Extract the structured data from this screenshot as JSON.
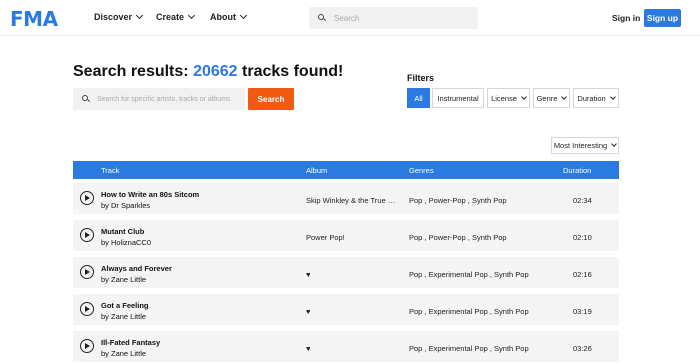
{
  "header": {
    "logo": "FMA",
    "nav": [
      {
        "label": "Discover"
      },
      {
        "label": "Create"
      },
      {
        "label": "About"
      }
    ],
    "search_placeholder": "Search",
    "signin": "Sign in",
    "signup": "Sign up"
  },
  "results": {
    "prefix": "Search results: ",
    "count": "20662",
    "suffix": " tracks found!",
    "search_placeholder": "Search for specific artists, tracks or albums",
    "search_button": "Search"
  },
  "filters": {
    "label": "Filters",
    "items": [
      {
        "label": "All",
        "active": true
      },
      {
        "label": "Instrumental",
        "active": false
      },
      {
        "label": "License",
        "active": false
      },
      {
        "label": "Genre",
        "active": false
      },
      {
        "label": "Duration",
        "active": false
      }
    ]
  },
  "sort": "Most Interesting",
  "table": {
    "headers": {
      "track": "Track",
      "album": "Album",
      "genres": "Genres",
      "duration": "Duration"
    },
    "rows": [
      {
        "title": "How to Write an 80s Sitcom",
        "artist": "by Dr Sparkles",
        "album": "Skip Winkley & the True Blu...",
        "genres": "Pop , Power-Pop , Synth Pop",
        "duration": "02:34"
      },
      {
        "title": "Mutant Club",
        "artist": "by HoliznaCC0",
        "album": "Power Pop!",
        "genres": "Pop , Power-Pop , Synth Pop",
        "duration": "02:10"
      },
      {
        "title": "Always and Forever",
        "artist": "by Zane Little",
        "album": "♥",
        "genres": "Pop , Experimental Pop , Synth Pop",
        "duration": "02:16"
      },
      {
        "title": "Got a Feeling",
        "artist": "by Zane Little",
        "album": "♥",
        "genres": "Pop , Experimental Pop , Synth Pop",
        "duration": "03:19"
      },
      {
        "title": "Ill-Fated Fantasy",
        "artist": "by Zane Little",
        "album": "♥",
        "genres": "Pop , Experimental Pop , Synth Pop",
        "duration": "03:26"
      }
    ]
  }
}
